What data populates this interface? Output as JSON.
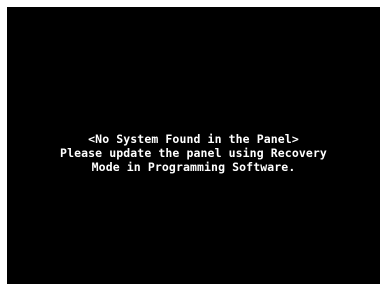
{
  "screen": {
    "background_color": "#000000",
    "text_color": "#ffffff",
    "lines": [
      "<No System Found in the Panel>",
      "Please update the panel using Recovery",
      "Mode in Programming Software."
    ]
  }
}
